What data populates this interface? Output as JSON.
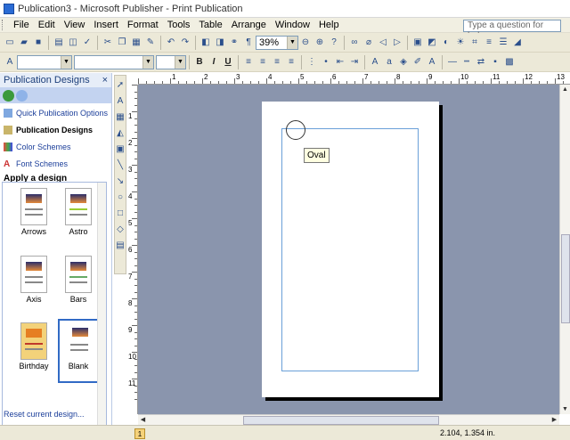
{
  "window": {
    "title": "Publication3 - Microsoft Publisher - Print Publication"
  },
  "menubar": {
    "items": [
      "File",
      "Edit",
      "View",
      "Insert",
      "Format",
      "Tools",
      "Table",
      "Arrange",
      "Window",
      "Help"
    ],
    "help_placeholder": "Type a question for help"
  },
  "standard_toolbar": {
    "zoom": "39%"
  },
  "formatting_toolbar": {
    "style": "",
    "font": "",
    "size": ""
  },
  "taskpane": {
    "title": "Publication Designs",
    "close": "×",
    "links": [
      "Quick Publication Options",
      "Publication Designs",
      "Color Schemes",
      "Font Schemes"
    ],
    "section": "Apply a design",
    "designs": [
      "Arrows",
      "Astro",
      "Axis",
      "Bars",
      "Birthday",
      "Blank"
    ],
    "footer": "Reset current design..."
  },
  "canvas": {
    "tooltip": "Oval"
  },
  "ruler": {
    "h_labels": [
      "1",
      "2",
      "3",
      "4",
      "5",
      "6",
      "7",
      "8",
      "9",
      "10",
      "11",
      "12",
      "13"
    ],
    "v_labels": [
      "1",
      "2",
      "3",
      "4",
      "5",
      "6",
      "7",
      "8",
      "9",
      "10",
      "11"
    ]
  },
  "statusbar": {
    "page": "1",
    "coordinates": "2.104, 1.354 in."
  },
  "colors": {
    "taskpane_header": "#e6edf8",
    "canvas_bg": "#8a95ad",
    "margin_guide": "#6aa0d8",
    "tooltip_bg": "#ffffe1"
  }
}
